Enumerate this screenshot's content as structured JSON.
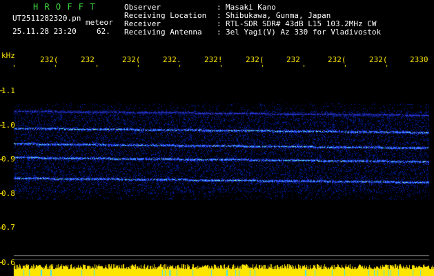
{
  "header": {
    "app_name": "H R O F F T",
    "filename": "UT2511282320.pn",
    "mode": "meteor",
    "datetime": "25.11.28 23:20",
    "extra_value": "62.",
    "fields": [
      {
        "label": "Observer",
        "sep": ":",
        "value": "Masaki Kano"
      },
      {
        "label": "Receiving Location",
        "sep": ":",
        "value": "Shibukawa, Gunma, Japan"
      },
      {
        "label": "Receiver",
        "sep": ":",
        "value": "RTL-SDR SDR# 43dB L15 103.2MHz CW"
      },
      {
        "label": "Receiving Antenna",
        "sep": ":",
        "value": "3el Yagi(V) Az 330 for Vladivostok"
      }
    ]
  },
  "time_axis": {
    "labels": [
      "232(",
      "232",
      "232(",
      "232.",
      "232!",
      "232(",
      "232",
      "232(",
      "232(",
      "2330"
    ]
  },
  "freq_axis": {
    "unit": "kHz",
    "labels": [
      "1.1",
      "1.0",
      "0.9",
      "0.8",
      "0.7",
      "0.6"
    ]
  },
  "colors": {
    "background": "#000000",
    "header_green": "#3fdc3f",
    "header_white": "#ffffff",
    "axis_yellow": "#ffe600",
    "signal_blue": "#2030ff",
    "signal_cyan": "#40e0ff"
  },
  "signal_traces_khz": [
    1.04,
    0.99,
    0.945,
    0.905,
    0.845
  ]
}
